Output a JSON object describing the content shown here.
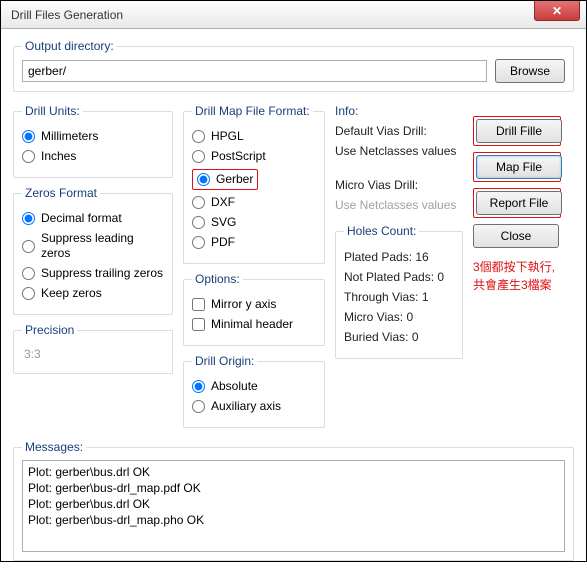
{
  "window": {
    "title": "Drill Files Generation",
    "close_glyph": "✕"
  },
  "output": {
    "legend": "Output directory:",
    "value": "gerber/",
    "browse": "Browse"
  },
  "drill_units": {
    "legend": "Drill Units:",
    "options": [
      "Millimeters",
      "Inches"
    ],
    "selected": 0
  },
  "zeros": {
    "legend": "Zeros Format",
    "options": [
      "Decimal format",
      "Suppress leading zeros",
      "Suppress trailing zeros",
      "Keep zeros"
    ],
    "selected": 0
  },
  "precision": {
    "legend": "Precision",
    "value": "3:3"
  },
  "drill_map": {
    "legend": "Drill Map File Format:",
    "options": [
      "HPGL",
      "PostScript",
      "Gerber",
      "DXF",
      "SVG",
      "PDF"
    ],
    "selected": 2
  },
  "options": {
    "legend": "Options:",
    "mirror": "Mirror y axis",
    "minimal": "Minimal header"
  },
  "origin": {
    "legend": "Drill Origin:",
    "options": [
      "Absolute",
      "Auxiliary axis"
    ],
    "selected": 0
  },
  "info": {
    "legend": "Info:",
    "default_vias": "Default Vias Drill:",
    "use_net1": "Use Netclasses values",
    "micro_vias": "Micro Vias Drill:",
    "use_net2": "Use Netclasses values",
    "holes_legend": "Holes Count:",
    "holes": {
      "plated": "Plated Pads: 16",
      "not_plated": "Not Plated Pads: 0",
      "through": "Through Vias: 1",
      "micro": "Micro Vias: 0",
      "buried": "Buried Vias: 0"
    }
  },
  "buttons": {
    "drill": "Drill Fille",
    "map": "Map File",
    "report": "Report File",
    "close": "Close"
  },
  "annotation": {
    "line1": "3個都按下執行,",
    "line2": "共會產生3檔案"
  },
  "messages": {
    "legend": "Messages:",
    "lines": [
      "Plot: gerber\\bus.drl OK",
      "Plot: gerber\\bus-drl_map.pdf OK",
      "Plot: gerber\\bus.drl OK",
      "Plot: gerber\\bus-drl_map.pho OK"
    ]
  }
}
